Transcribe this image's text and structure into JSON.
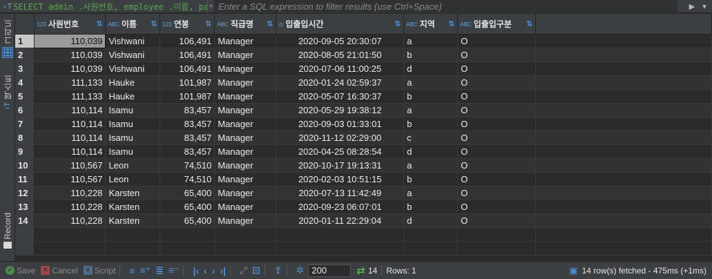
{
  "query_preview": "SELECT admin .사원번호, employee .이름, pay. f",
  "filter_placeholder": "Enter a SQL expression to filter results (use Ctrl+Space)",
  "left_tabs": {
    "grid": "그리드",
    "text": "텍스트",
    "record": "Record"
  },
  "columns": [
    {
      "type": "123",
      "name": "사원번호"
    },
    {
      "type": "ABC",
      "name": "이름"
    },
    {
      "type": "123",
      "name": "연봉"
    },
    {
      "type": "ABC",
      "name": "직급명"
    },
    {
      "type": "◷",
      "name": "입출입시간"
    },
    {
      "type": "ABC",
      "name": "지역"
    },
    {
      "type": "ABC",
      "name": "입출입구분"
    }
  ],
  "rows": [
    [
      "1",
      "110,039",
      "Vishwani",
      "106,491",
      "Manager",
      "2020-09-05 20:30:07",
      "a",
      "O"
    ],
    [
      "2",
      "110,039",
      "Vishwani",
      "106,491",
      "Manager",
      "2020-08-05 21:01:50",
      "b",
      "O"
    ],
    [
      "3",
      "110,039",
      "Vishwani",
      "106,491",
      "Manager",
      "2020-07-06 11:00:25",
      "d",
      "O"
    ],
    [
      "4",
      "111,133",
      "Hauke",
      "101,987",
      "Manager",
      "2020-01-24 02:59:37",
      "a",
      "O"
    ],
    [
      "5",
      "111,133",
      "Hauke",
      "101,987",
      "Manager",
      "2020-05-07 16:30:37",
      "b",
      "O"
    ],
    [
      "6",
      "110,114",
      "Isamu",
      "83,457",
      "Manager",
      "2020-05-29 19:38:12",
      "a",
      "O"
    ],
    [
      "7",
      "110,114",
      "Isamu",
      "83,457",
      "Manager",
      "2020-09-03 01:33:01",
      "b",
      "O"
    ],
    [
      "8",
      "110,114",
      "Isamu",
      "83,457",
      "Manager",
      "2020-11-12 02:29:00",
      "c",
      "O"
    ],
    [
      "9",
      "110,114",
      "Isamu",
      "83,457",
      "Manager",
      "2020-04-25 08:28:54",
      "d",
      "O"
    ],
    [
      "10",
      "110,567",
      "Leon",
      "74,510",
      "Manager",
      "2020-10-17 19:13:31",
      "a",
      "O"
    ],
    [
      "11",
      "110,567",
      "Leon",
      "74,510",
      "Manager",
      "2020-02-03 10:51:15",
      "b",
      "O"
    ],
    [
      "12",
      "110,228",
      "Karsten",
      "65,400",
      "Manager",
      "2020-07-13 11:42:49",
      "a",
      "O"
    ],
    [
      "13",
      "110,228",
      "Karsten",
      "65,400",
      "Manager",
      "2020-09-23 06:07:01",
      "b",
      "O"
    ],
    [
      "14",
      "110,228",
      "Karsten",
      "65,400",
      "Manager",
      "2020-01-11 22:29:04",
      "d",
      "O"
    ]
  ],
  "toolbar": {
    "save": "Save",
    "cancel": "Cancel",
    "script": "Script",
    "page_size": "200",
    "rows_count": "14",
    "rows_label": "Rows: 1",
    "status": "14 row(s) fetched - 475ms (+1ms)"
  }
}
